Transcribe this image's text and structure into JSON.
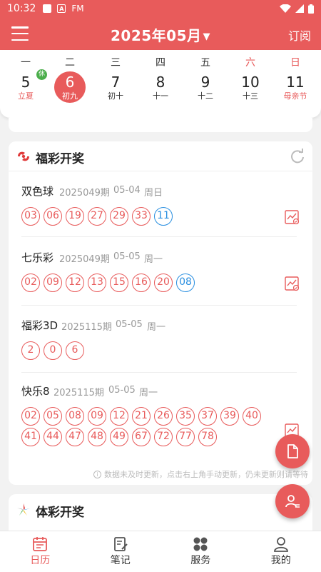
{
  "status_bar": {
    "time": "10:32",
    "fm_label": "FM"
  },
  "header": {
    "title": "2025年05月",
    "subscribe_label": "订阅"
  },
  "calendar": {
    "days": [
      {
        "weekday": "一",
        "date": "5",
        "lunar": "立夏",
        "lunar_red": true,
        "badge": "休"
      },
      {
        "weekday": "二",
        "date": "6",
        "lunar": "初九",
        "selected": true
      },
      {
        "weekday": "三",
        "date": "7",
        "lunar": "初十"
      },
      {
        "weekday": "四",
        "date": "8",
        "lunar": "十一"
      },
      {
        "weekday": "五",
        "date": "9",
        "lunar": "十二"
      },
      {
        "weekday": "六",
        "date": "10",
        "lunar": "十三",
        "weekday_red": true
      },
      {
        "weekday": "日",
        "date": "11",
        "lunar": "母亲节",
        "weekday_red": true,
        "lunar_red": true
      }
    ]
  },
  "welfare_lottery": {
    "title": "福彩开奖",
    "items": [
      {
        "name": "双色球",
        "issue": "2025049期",
        "date": "05-04",
        "weekday": "周日",
        "red_balls": [
          "03",
          "06",
          "19",
          "27",
          "29",
          "33"
        ],
        "blue_balls": [
          "11"
        ]
      },
      {
        "name": "七乐彩",
        "issue": "2025049期",
        "date": "05-05",
        "weekday": "周一",
        "red_balls": [
          "02",
          "09",
          "12",
          "13",
          "15",
          "16",
          "20"
        ],
        "blue_balls": [
          "08"
        ]
      },
      {
        "name": "福彩3D",
        "issue": "2025115期",
        "date": "05-05",
        "weekday": "周一",
        "red_balls": [
          "2",
          "0",
          "6"
        ],
        "blue_balls": []
      },
      {
        "name": "快乐8",
        "issue": "2025115期",
        "date": "05-05",
        "weekday": "周一",
        "red_balls": [
          "02",
          "05",
          "08",
          "09",
          "12",
          "21",
          "26",
          "35",
          "37",
          "39",
          "40",
          "41",
          "44",
          "47",
          "48",
          "49",
          "67",
          "72",
          "77",
          "78"
        ],
        "blue_balls": []
      }
    ],
    "note": "数据未及时更新，点击右上角手动更新，仍未更新则请等待"
  },
  "sports_lottery": {
    "title": "体彩开奖"
  },
  "bottom_nav": [
    {
      "label": "日历",
      "icon": "calendar-icon",
      "active": true
    },
    {
      "label": "笔记",
      "icon": "note-icon"
    },
    {
      "label": "服务",
      "icon": "services-icon"
    },
    {
      "label": "我的",
      "icon": "profile-icon"
    }
  ],
  "colors": {
    "primary": "#e85b5b",
    "blue_ball": "#2a8fe0",
    "rest_badge": "#4cae4c"
  }
}
